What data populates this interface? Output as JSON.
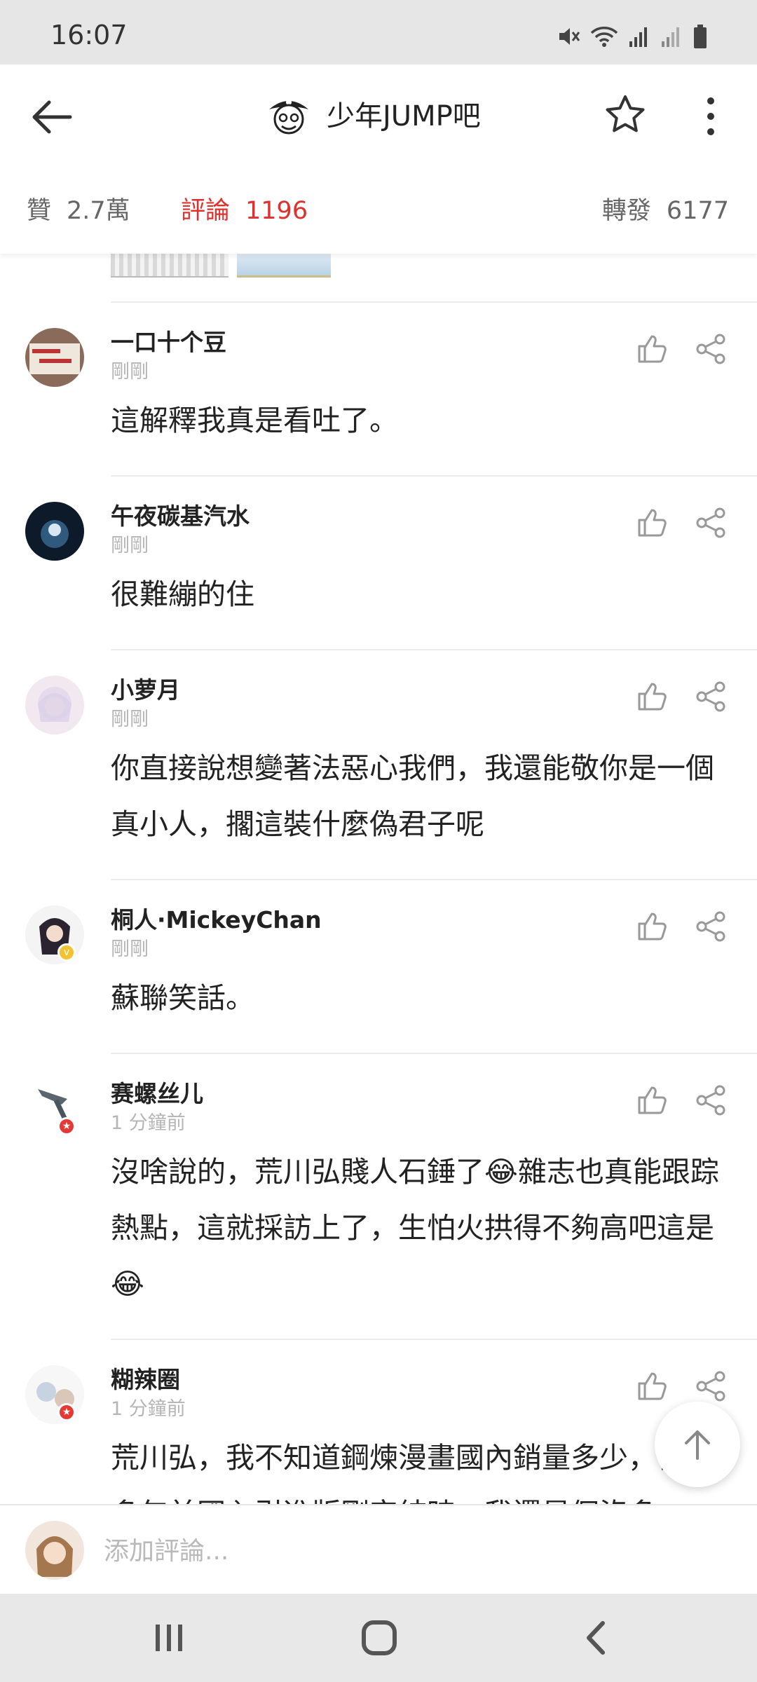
{
  "status_bar": {
    "time": "16:07"
  },
  "header": {
    "title": "少年JUMP吧",
    "stats": {
      "likes_label": "贊",
      "likes_value": "2.7萬",
      "comments_label": "評論",
      "comments_value": "1196",
      "reposts_label": "轉發",
      "reposts_value": "6177"
    }
  },
  "comments": [
    {
      "username": "一口十个豆",
      "time": "剛剛",
      "content": "這解釋我真是看吐了。"
    },
    {
      "username": "午夜碳基汽水",
      "time": "剛剛",
      "content": "很難繃的住"
    },
    {
      "username": "小萝月",
      "time": "剛剛",
      "content": "你直接說想變著法惡心我們，我還能敬你是一個真小人，擱這裝什麼偽君子呢"
    },
    {
      "username": "桐人·MickeyChan",
      "time": "剛剛",
      "content": "蘇聯笑話。"
    },
    {
      "username": "赛螺丝儿",
      "time": "1 分鐘前",
      "content": "沒啥說的，荒川弘賤人石錘了😂雜志也真能跟踪熱點，這就採訪上了，生怕火拱得不夠高吧這是😂"
    },
    {
      "username": "糊辣圈",
      "time": "1 分鐘前",
      "content": "荒川弘，我不知道鋼煉漫畫國內銷量多少，但十多年前國內引進版剛完結時，我還是個沒多"
    }
  ],
  "input": {
    "placeholder": "添加評論..."
  },
  "colors": {
    "accent_red": "#e0302d",
    "text_dark": "#222222",
    "text_muted": "#b5b5b5"
  }
}
